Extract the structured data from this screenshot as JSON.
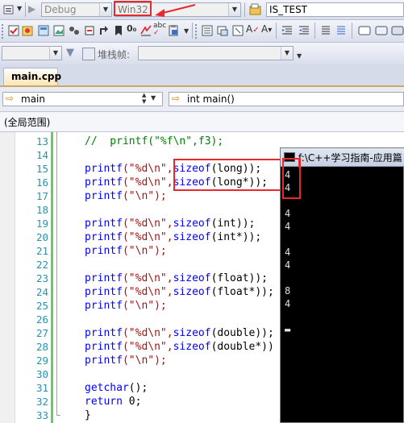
{
  "toolbar1": {
    "config": "Debug",
    "platform": "Win32",
    "project": "IS_TEST"
  },
  "toolbar2": {
    "icons": [
      "properties-icon",
      "class-wizard-icon",
      "resource-icon",
      "object-browser-icon",
      "stop-icon",
      "toggle-icon",
      "find-icon",
      "spell-check-icon",
      "clipboard-icon",
      "indent-icon",
      "outdent-icon",
      "comment-icon",
      "uncomment-icon",
      "window-icon"
    ]
  },
  "toolbar3": {
    "stack_label": "堆栈帧:",
    "stack_value": ""
  },
  "tab": {
    "label": "main.cpp"
  },
  "nav": {
    "scope": "main",
    "function": "int main()"
  },
  "scope_bar": {
    "label": "(全局范围)"
  },
  "code_lines": [
    {
      "n": "13",
      "segs": [
        [
          "cm",
          "//  printf(\"%f\\n\",f3);"
        ]
      ]
    },
    {
      "n": "14",
      "segs": []
    },
    {
      "n": "15",
      "segs": [
        [
          "kw",
          "printf"
        ],
        [
          "str",
          "(\"%d\\n\","
        ],
        [
          "kw",
          "sizeof"
        ],
        [
          "blk",
          "(long));"
        ]
      ]
    },
    {
      "n": "16",
      "segs": [
        [
          "kw",
          "printf"
        ],
        [
          "str",
          "(\"%d\\n\","
        ],
        [
          "kw",
          "sizeof"
        ],
        [
          "blk",
          "(long*));"
        ]
      ]
    },
    {
      "n": "17",
      "segs": [
        [
          "kw",
          "printf"
        ],
        [
          "str",
          "(\"\\n\");"
        ]
      ]
    },
    {
      "n": "18",
      "segs": []
    },
    {
      "n": "19",
      "segs": [
        [
          "kw",
          "printf"
        ],
        [
          "str",
          "(\"%d\\n\","
        ],
        [
          "kw",
          "sizeof"
        ],
        [
          "blk",
          "(int));"
        ]
      ]
    },
    {
      "n": "20",
      "segs": [
        [
          "kw",
          "printf"
        ],
        [
          "str",
          "(\"%d\\n\","
        ],
        [
          "kw",
          "sizeof"
        ],
        [
          "blk",
          "(int*));"
        ]
      ]
    },
    {
      "n": "21",
      "segs": [
        [
          "kw",
          "printf"
        ],
        [
          "str",
          "(\"\\n\");"
        ]
      ]
    },
    {
      "n": "22",
      "segs": []
    },
    {
      "n": "23",
      "segs": [
        [
          "kw",
          "printf"
        ],
        [
          "str",
          "(\"%d\\n\","
        ],
        [
          "kw",
          "sizeof"
        ],
        [
          "blk",
          "(float));"
        ]
      ]
    },
    {
      "n": "24",
      "segs": [
        [
          "kw",
          "printf"
        ],
        [
          "str",
          "(\"%d\\n\","
        ],
        [
          "kw",
          "sizeof"
        ],
        [
          "blk",
          "(float*));"
        ]
      ]
    },
    {
      "n": "25",
      "segs": [
        [
          "kw",
          "printf"
        ],
        [
          "str",
          "(\"\\n\");"
        ]
      ]
    },
    {
      "n": "26",
      "segs": []
    },
    {
      "n": "27",
      "segs": [
        [
          "kw",
          "printf"
        ],
        [
          "str",
          "(\"%d\\n\","
        ],
        [
          "kw",
          "sizeof"
        ],
        [
          "blk",
          "(double));"
        ]
      ]
    },
    {
      "n": "28",
      "segs": [
        [
          "kw",
          "printf"
        ],
        [
          "str",
          "(\"%d\\n\","
        ],
        [
          "kw",
          "sizeof"
        ],
        [
          "blk",
          "(double*))"
        ]
      ]
    },
    {
      "n": "29",
      "segs": [
        [
          "kw",
          "printf"
        ],
        [
          "str",
          "(\"\\n\");"
        ]
      ]
    },
    {
      "n": "30",
      "segs": []
    },
    {
      "n": "31",
      "segs": [
        [
          "kw",
          "getchar"
        ],
        [
          "blk",
          "();"
        ]
      ]
    },
    {
      "n": "32",
      "segs": [
        [
          "kw",
          "return"
        ],
        [
          "blk",
          " 0;"
        ]
      ]
    },
    {
      "n": "33",
      "segs": [
        [
          "blk",
          "}"
        ]
      ]
    }
  ],
  "console": {
    "title": "f:\\C++学习指南-应用篇",
    "lines": [
      "4",
      "4",
      "",
      "4",
      "4",
      "",
      "4",
      "4",
      "",
      "8",
      "4",
      "",
      "▬"
    ]
  },
  "colors": {
    "highlight": "#e8282d",
    "console_bg": "#000000",
    "keyword": "#0000ff",
    "string": "#a31515",
    "comment": "#008000"
  }
}
